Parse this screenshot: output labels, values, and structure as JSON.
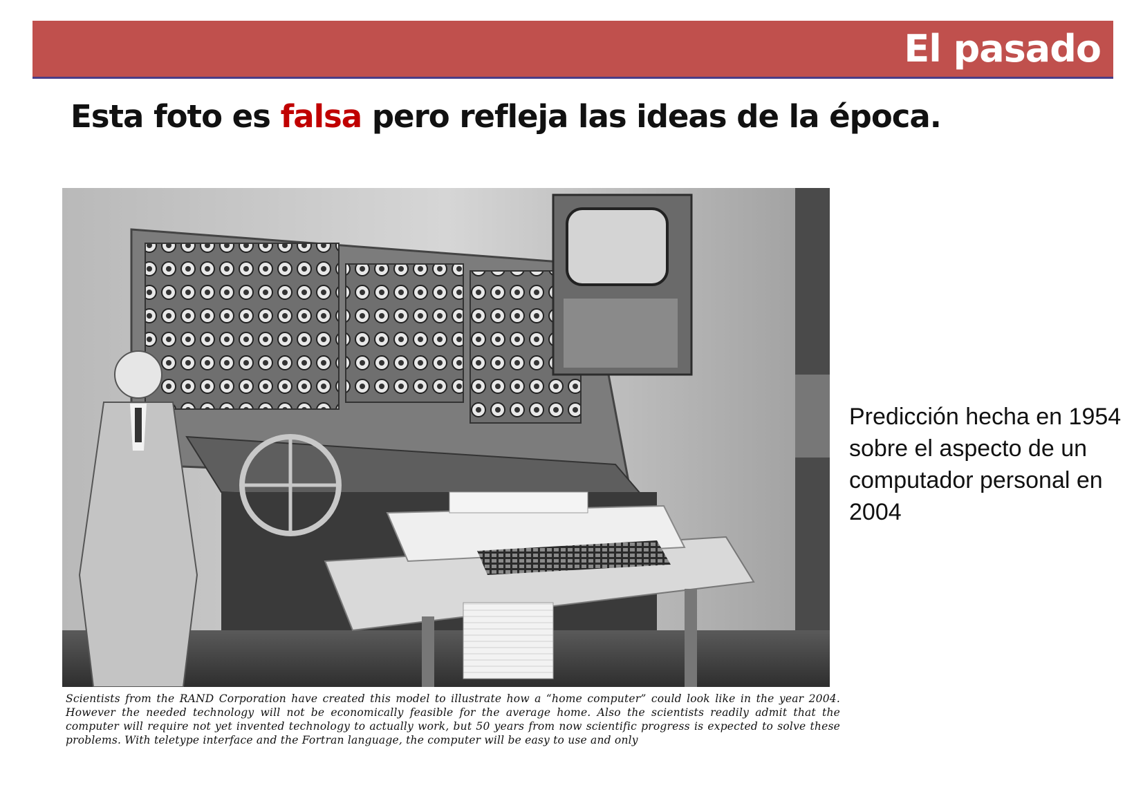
{
  "slide": {
    "title": "El pasado",
    "headline_before": "Esta foto es ",
    "headline_highlight": "falsa",
    "headline_after": " pero refleja las ideas de la época.",
    "photo_caption": "Scientists from the RAND Corporation have created this model to illustrate how a “home computer” could look like in the year 2004. However the needed technology will not be economically feasible for the average home. Also the scientists readily admit that the computer will require not yet invented technology to actually work, but 50 years from now scientific progress is expected to solve these problems. With teletype interface and the Fortran language, the computer will be easy to use and only",
    "side_text": "Predicción hecha en 1954 sobre el aspecto de un computador personal en 2004"
  },
  "colors": {
    "header_bar": "#c0504d",
    "header_underline": "#4a3d87",
    "highlight": "#c00000"
  }
}
